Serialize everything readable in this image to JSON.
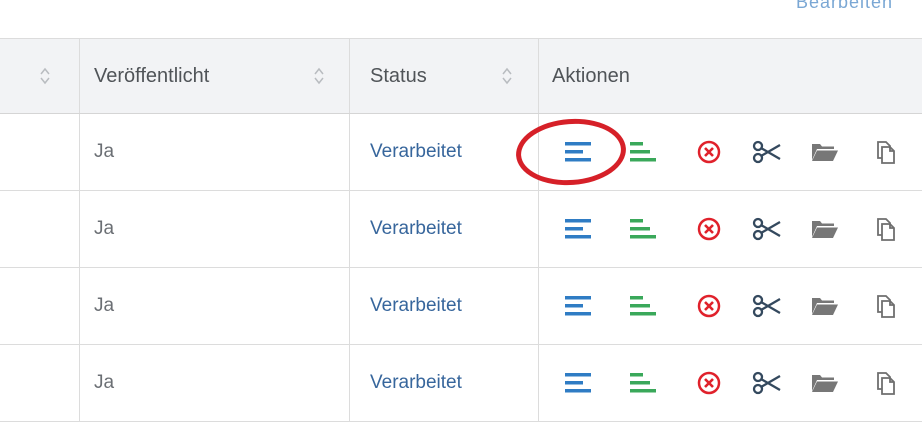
{
  "top_fragment": "Bearbeiten",
  "table": {
    "headers": {
      "col0": "",
      "published": "Veröffentlicht",
      "status": "Status",
      "actions": "Aktionen"
    },
    "rows": [
      {
        "published": "Ja",
        "status": "Verarbeitet"
      },
      {
        "published": "Ja",
        "status": "Verarbeitet"
      },
      {
        "published": "Ja",
        "status": "Verarbeitet"
      },
      {
        "published": "Ja",
        "status": "Verarbeitet"
      }
    ]
  },
  "icons": {
    "details": "align-left-icon",
    "details_alt": "align-left-green-icon",
    "delete": "close-circle-icon",
    "cut": "scissors-icon",
    "move": "folder-icon",
    "copy": "copy-icon"
  },
  "colors": {
    "blue_icon": "#2f7cc4",
    "green_icon": "#3aa85a",
    "red_icon": "#e0212b",
    "dark_icon": "#34495e",
    "gray_icon": "#777777",
    "status_text": "#37669c",
    "annotation": "#d62028"
  }
}
